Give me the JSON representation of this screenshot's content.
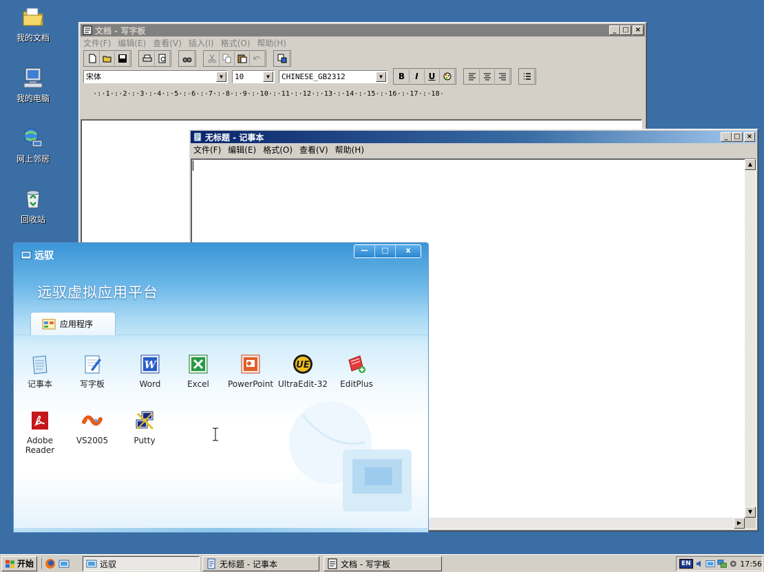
{
  "desktop": {
    "icons": [
      {
        "label": "我的文档",
        "icon": "folder-documents-icon"
      },
      {
        "label": "我的电脑",
        "icon": "computer-icon"
      },
      {
        "label": "网上邻居",
        "icon": "network-icon"
      },
      {
        "label": "回收站",
        "icon": "recycle-bin-icon"
      }
    ]
  },
  "wordpad": {
    "title": "文档 - 写字板",
    "menu": [
      "文件(F)",
      "编辑(E)",
      "查看(V)",
      "插入(I)",
      "格式(O)",
      "帮助(H)"
    ],
    "font_name": "宋体",
    "font_size": "10",
    "script": "CHINESE_GB2312",
    "format_buttons": [
      "B",
      "I",
      "U"
    ],
    "ruler": "·:·1·:·2·:·3·:·4·:·5·:·6·:·7·:·8·:·9·:·10·:·11·:·12·:·13·:·14·:·15·:·16·:·17·:·18·"
  },
  "notepad": {
    "title": "无标题 - 记事本",
    "menu": [
      "文件(F)",
      "编辑(E)",
      "格式(O)",
      "查看(V)",
      "帮助(H)"
    ],
    "content": ""
  },
  "yuanyu": {
    "title": "远驭",
    "heading": "远驭虚拟应用平台",
    "tab_label": "应用程序",
    "apps": [
      {
        "label": "记事本",
        "icon": "notepad-icon"
      },
      {
        "label": "写字板",
        "icon": "wordpad-icon"
      },
      {
        "label": "Word",
        "icon": "word-icon"
      },
      {
        "label": "Excel",
        "icon": "excel-icon"
      },
      {
        "label": "PowerPoint",
        "icon": "powerpoint-icon"
      },
      {
        "label": "UltraEdit-32",
        "icon": "ultraedit-icon"
      },
      {
        "label": "EditPlus",
        "icon": "editplus-icon"
      },
      {
        "label": "Adobe Reader",
        "icon": "adobe-reader-icon"
      },
      {
        "label": "VS2005",
        "icon": "vs2005-icon"
      },
      {
        "label": "Putty",
        "icon": "putty-icon"
      }
    ]
  },
  "taskbar": {
    "start_label": "开始",
    "tasks": [
      "远驭",
      "无标题 - 记事本",
      "文档 - 写字板"
    ],
    "lang": "EN",
    "clock": "17:56"
  },
  "colors": {
    "desktop": "#3a6ea5",
    "title_active": "#0a246a",
    "title_inactive": "#808080",
    "face": "#d4d0c8"
  }
}
